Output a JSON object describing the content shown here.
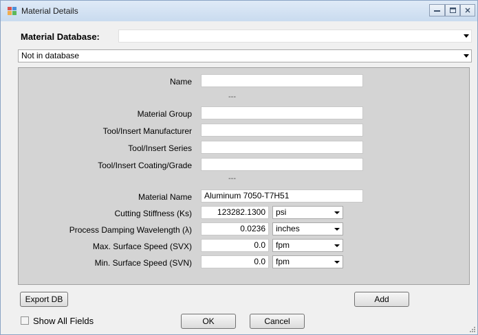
{
  "window": {
    "title": "Material Details",
    "minimize_icon": "minimize-icon",
    "maximize_icon": "maximize-icon",
    "close_icon": "close-icon"
  },
  "database": {
    "label": "Material Database:",
    "value": "",
    "source": "Not in database"
  },
  "fields": {
    "name": {
      "label": "Name",
      "value": ""
    },
    "sep1": "---",
    "material_group": {
      "label": "Material Group",
      "value": ""
    },
    "manufacturer": {
      "label": "Tool/Insert Manufacturer",
      "value": ""
    },
    "series": {
      "label": "Tool/Insert Series",
      "value": ""
    },
    "coating": {
      "label": "Tool/Insert Coating/Grade",
      "value": ""
    },
    "sep2": "---",
    "material_name": {
      "label": "Material Name",
      "value": "Aluminum 7050-T7H51"
    },
    "cutting_stiffness": {
      "label": "Cutting Stiffness (Ks)",
      "value": "123282.1300",
      "unit": "psi"
    },
    "damping": {
      "label": "Process Damping Wavelength (λ)",
      "value": "0.0236",
      "unit": "inches"
    },
    "max_speed": {
      "label": "Max. Surface Speed (SVX)",
      "value": "0.0",
      "unit": "fpm"
    },
    "min_speed": {
      "label": "Min. Surface Speed (SVN)",
      "value": "0.0",
      "unit": "fpm"
    }
  },
  "buttons": {
    "export": "Export DB",
    "add": "Add",
    "ok": "OK",
    "cancel": "Cancel"
  },
  "show_all": {
    "label": "Show All Fields",
    "checked": false
  }
}
